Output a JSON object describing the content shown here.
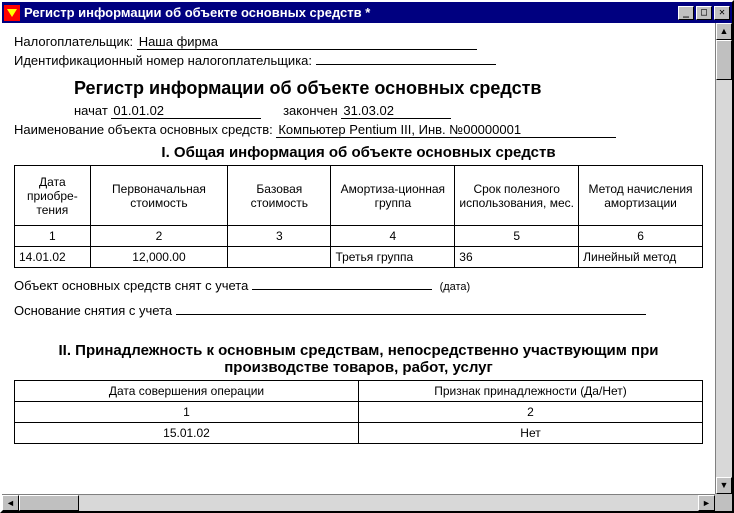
{
  "window": {
    "title": "Регистр информации об объекте основных средств  *"
  },
  "taxpayer": {
    "label": "Налогоплательщик:",
    "value": "Наша фирма"
  },
  "inn": {
    "label": "Идентификационный номер налогоплательщика:",
    "value": ""
  },
  "report_title": "Регистр информации об объекте основных средств",
  "period": {
    "start_label": "начат",
    "start": "01.01.02",
    "end_label": "закончен",
    "end": "31.03.02"
  },
  "object": {
    "label": "Наименование объекта основных средств:",
    "value": "Компьютер Pentium III, Инв. №00000001"
  },
  "section1": {
    "title": "I. Общая информация об объекте основных средств",
    "headers": {
      "c1": "Дата приобре-тения",
      "c2": "Первоначальная стоимость",
      "c3": "Базовая стоимость",
      "c4": "Амортиза-ционная группа",
      "c5": "Срок полезного использования, мес.",
      "c6": "Метод начисления амортизации"
    },
    "nums": {
      "c1": "1",
      "c2": "2",
      "c3": "3",
      "c4": "4",
      "c5": "5",
      "c6": "6"
    },
    "row": {
      "c1": "14.01.02",
      "c2": "12,000.00",
      "c3": "",
      "c4": "Третья группа",
      "c5": "36",
      "c6": "Линейный метод"
    }
  },
  "removal": {
    "label": "Объект основных средств снят с учета",
    "value": "",
    "date_note": "(дата)"
  },
  "reason": {
    "label": "Основание снятия с учета",
    "value": ""
  },
  "section2": {
    "title": "II. Принадлежность к основным средствам, непосредственно участвующим при производстве товаров, работ, услуг",
    "headers": {
      "c1": "Дата совершения операции",
      "c2": "Признак принадлежности (Да/Нет)"
    },
    "nums": {
      "c1": "1",
      "c2": "2"
    },
    "row": {
      "c1": "15.01.02",
      "c2": "Нет"
    }
  }
}
